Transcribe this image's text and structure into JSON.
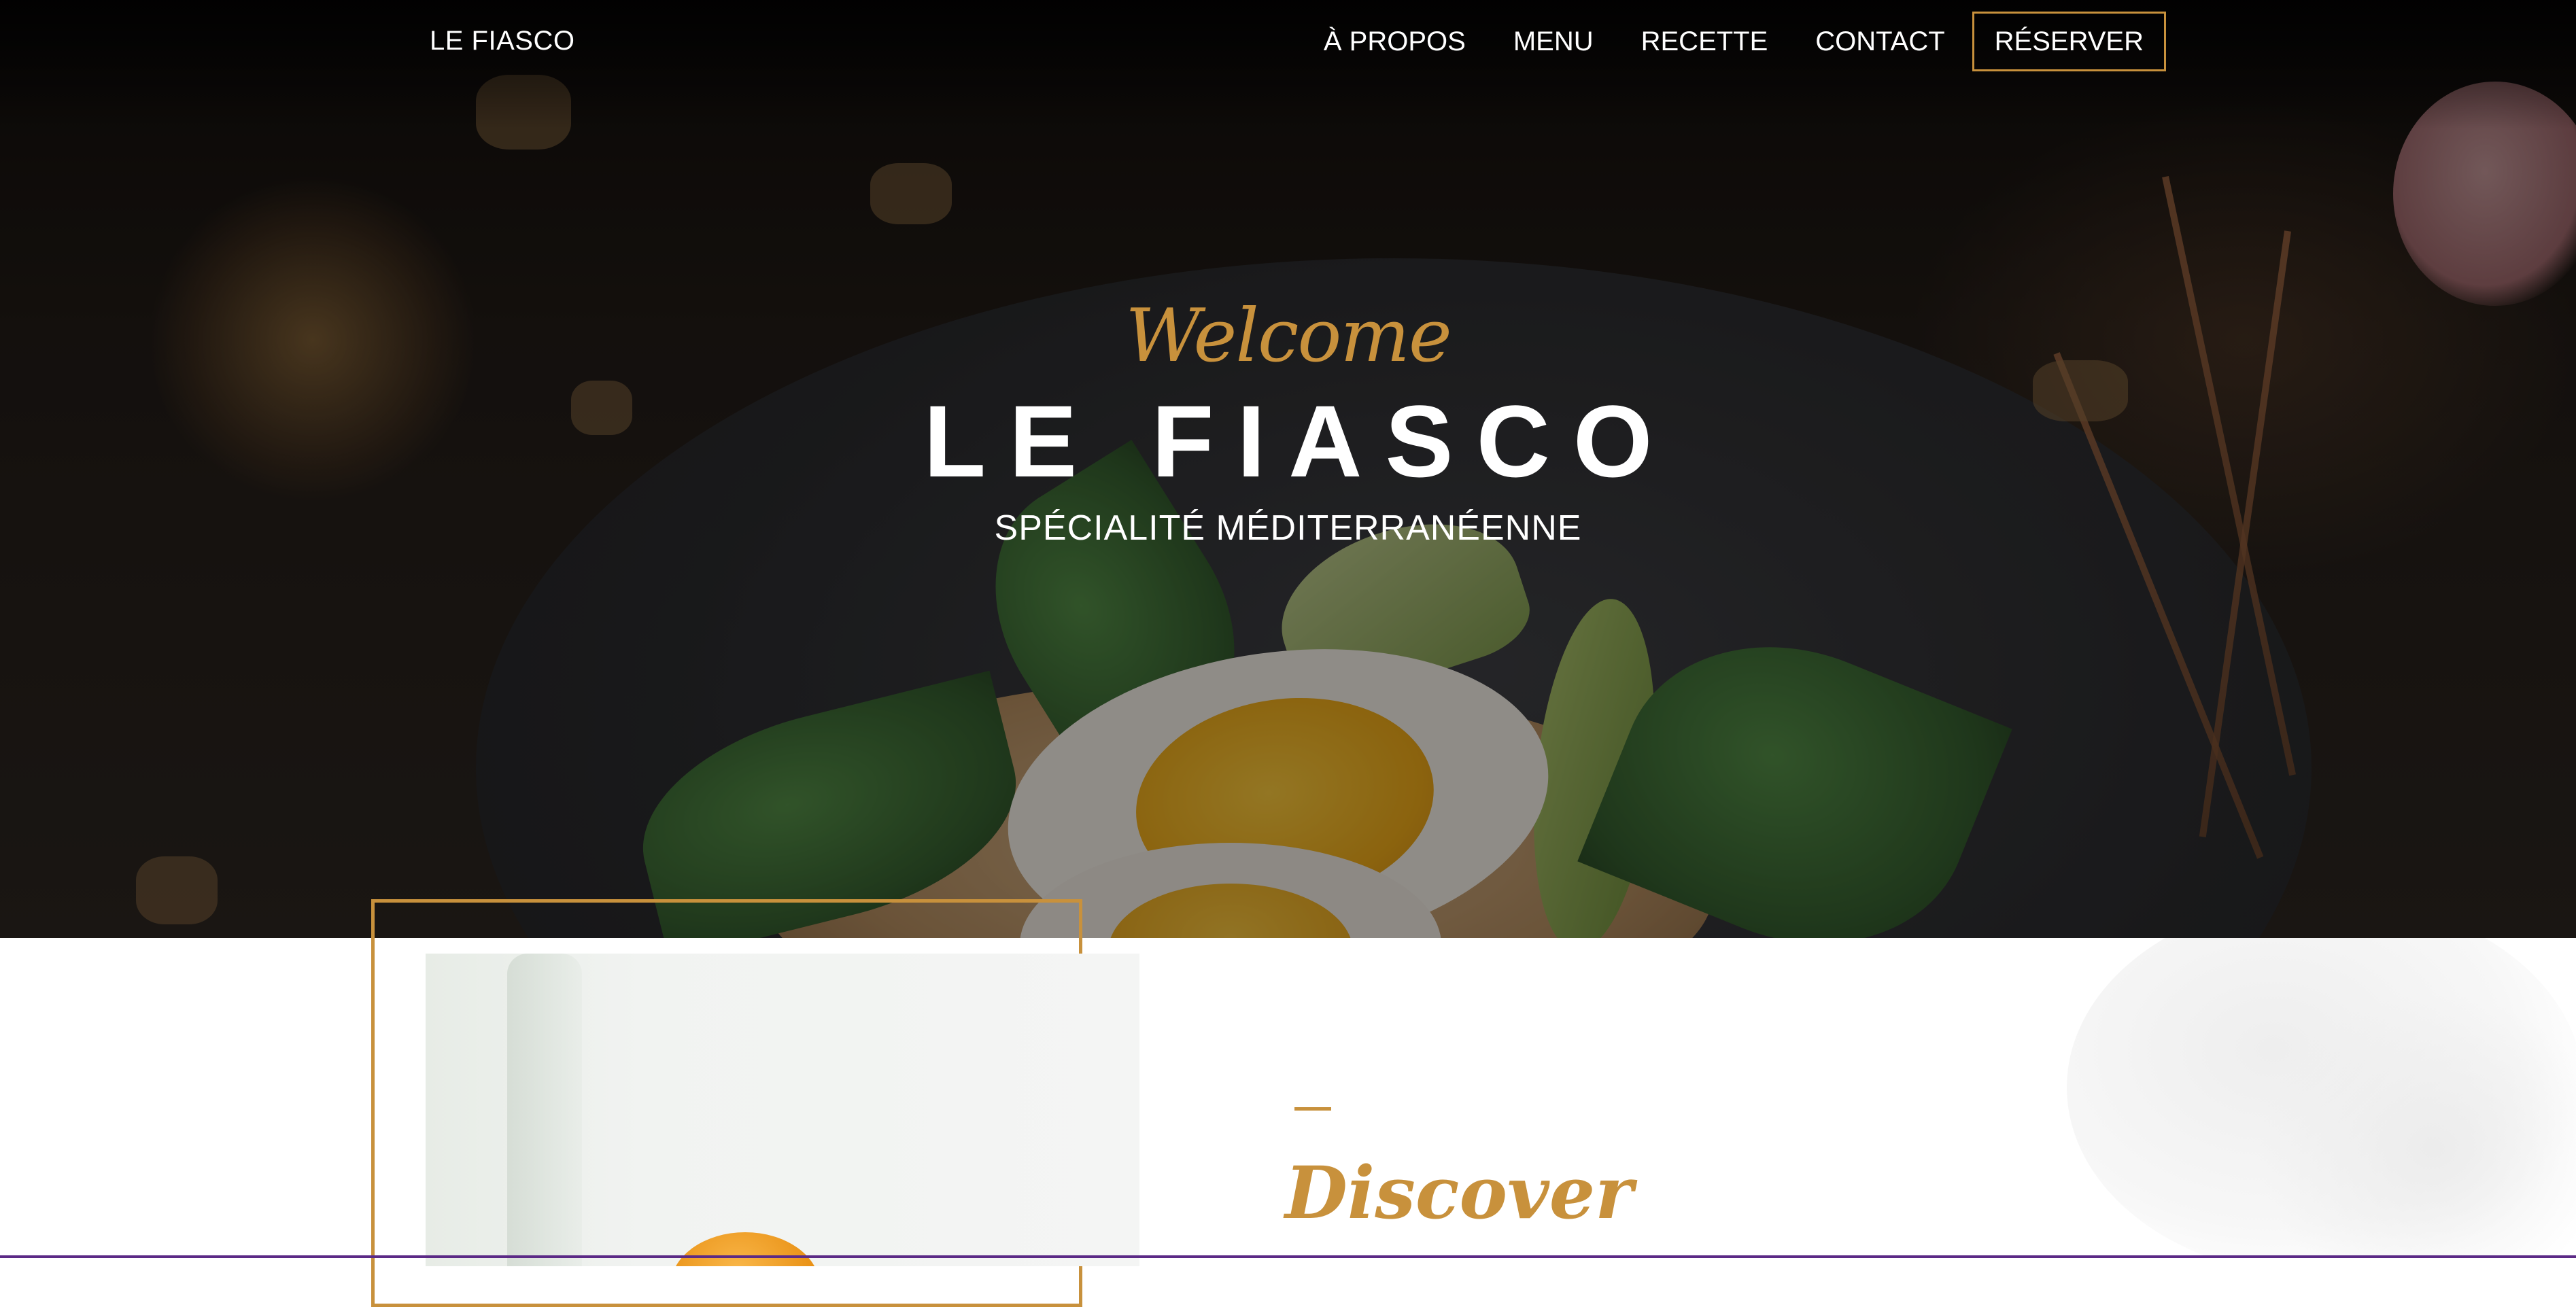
{
  "nav": {
    "brand": "LE FIASCO",
    "links": [
      {
        "label": "À PROPOS"
      },
      {
        "label": "MENU"
      },
      {
        "label": "RECETTE"
      },
      {
        "label": "CONTACT"
      }
    ],
    "reserve_label": "RÉSERVER"
  },
  "hero": {
    "welcome": "Welcome",
    "title": "LE FIASCO",
    "subtitle": "SPÉCIALITÉ MÉDITERRANÉENNE"
  },
  "about": {
    "heading": "Discover"
  },
  "colors": {
    "accent": "#c8913c",
    "text_light": "#ffffff",
    "hero_dark": "#1c1712"
  }
}
